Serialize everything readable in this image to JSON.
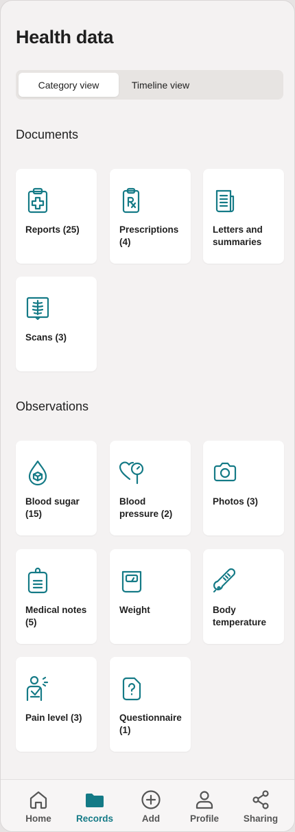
{
  "header": {
    "title": "Health data"
  },
  "view_toggle": {
    "active": "Category view",
    "inactive": "Timeline view"
  },
  "documents": {
    "title": "Documents",
    "items": [
      {
        "label": "Reports (25)",
        "icon": "clipboard-plus-icon"
      },
      {
        "label": "Prescriptions (4)",
        "icon": "prescription-icon"
      },
      {
        "label": "Letters and summaries",
        "icon": "document-lines-icon"
      },
      {
        "label": "Scans (3)",
        "icon": "xray-scan-icon"
      }
    ]
  },
  "observations": {
    "title": "Observations",
    "items": [
      {
        "label": "Blood sugar (15)",
        "icon": "blood-drop-icon"
      },
      {
        "label": "Blood pressure (2)",
        "icon": "heart-gauge-icon"
      },
      {
        "label": "Photos (3)",
        "icon": "camera-icon"
      },
      {
        "label": "Medical notes (5)",
        "icon": "clipboard-notes-icon"
      },
      {
        "label": "Weight",
        "icon": "scale-icon"
      },
      {
        "label": "Body temperature",
        "icon": "thermometer-icon"
      },
      {
        "label": "Pain level (3)",
        "icon": "pain-person-icon"
      },
      {
        "label": "Questionnaire (1)",
        "icon": "question-document-icon"
      }
    ]
  },
  "bottom_nav": {
    "items": [
      {
        "label": "Home",
        "icon": "home-icon"
      },
      {
        "label": "Records",
        "icon": "folder-icon",
        "active": true
      },
      {
        "label": "Add",
        "icon": "plus-circle-icon"
      },
      {
        "label": "Profile",
        "icon": "person-icon"
      },
      {
        "label": "Sharing",
        "icon": "share-icon"
      }
    ]
  },
  "colors": {
    "accent": "#147a86",
    "background": "#f4f2f2",
    "card": "#ffffff",
    "text": "#1f1f1f"
  }
}
